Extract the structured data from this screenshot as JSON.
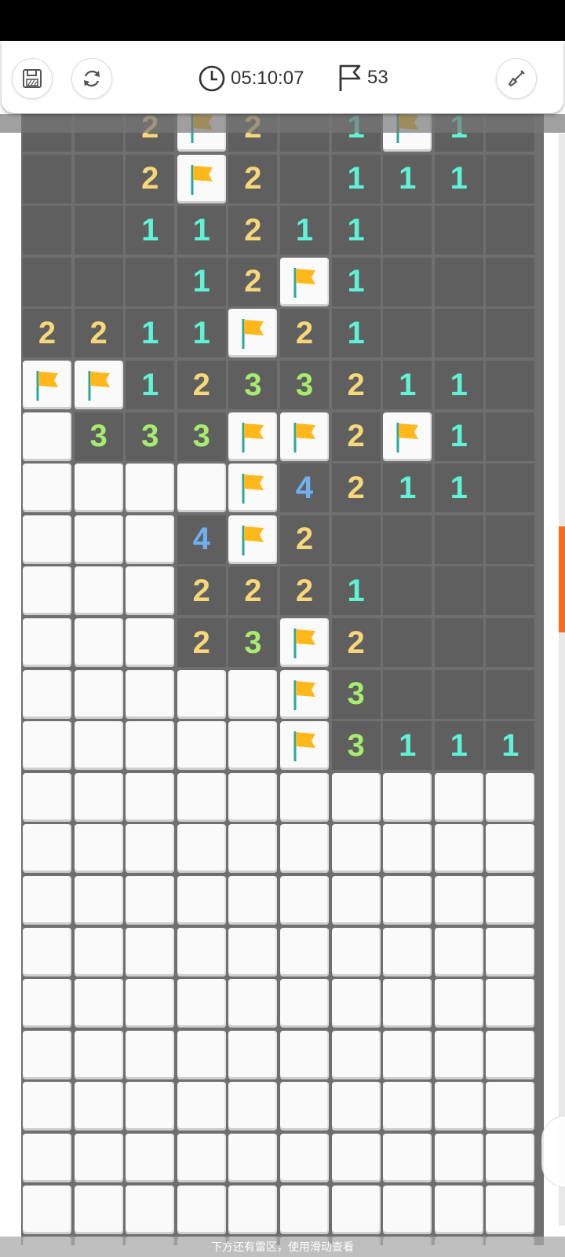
{
  "header": {
    "timer": "05:10:07",
    "flags_count": "53"
  },
  "footer": {
    "hint": "下方还有雷区，使用滑动查看"
  },
  "colors": {
    "num_1": "#5ff2d4",
    "num_2": "#f7d77a",
    "num_3": "#a6ec6e",
    "num_4": "#6fb0ee",
    "flag": "#ffb81c",
    "revealed": "#5f5f5f",
    "grid": "#6f6f6f",
    "unrevealed": "#fafafa",
    "accent": "#ff6a1a"
  },
  "icons": [
    "save-icon",
    "restart-icon",
    "clock-icon",
    "flag-outline-icon",
    "shovel-icon",
    "flag-icon"
  ],
  "board": {
    "rows": [
      [
        "R",
        "R",
        "2",
        "F",
        "2",
        "R",
        "1",
        "F",
        "1",
        "R"
      ],
      [
        "R",
        "R",
        "2",
        "F",
        "2",
        "R",
        "1",
        "1",
        "1",
        "R"
      ],
      [
        "R",
        "R",
        "1",
        "1",
        "2",
        "1",
        "1",
        "R",
        "R",
        "R"
      ],
      [
        "R",
        "R",
        "R",
        "1",
        "2",
        "F",
        "1",
        "R",
        "R",
        "R"
      ],
      [
        "2",
        "2",
        "1",
        "1",
        "F",
        "2",
        "1",
        "R",
        "R",
        "R"
      ],
      [
        "F",
        "F",
        "1",
        "2",
        "3",
        "3",
        "2",
        "1",
        "1",
        "R"
      ],
      [
        "U",
        "3",
        "3",
        "3",
        "F",
        "F",
        "2",
        "F",
        "1",
        "R"
      ],
      [
        "U",
        "U",
        "U",
        "U",
        "F",
        "4",
        "2",
        "1",
        "1",
        "R"
      ],
      [
        "U",
        "U",
        "U",
        "4",
        "F",
        "2",
        "R",
        "R",
        "R",
        "R"
      ],
      [
        "U",
        "U",
        "U",
        "2",
        "2",
        "2",
        "1",
        "R",
        "R",
        "R"
      ],
      [
        "U",
        "U",
        "U",
        "2",
        "3",
        "F",
        "2",
        "R",
        "R",
        "R"
      ],
      [
        "U",
        "U",
        "U",
        "U",
        "U",
        "F",
        "3",
        "R",
        "R",
        "R"
      ],
      [
        "U",
        "U",
        "U",
        "U",
        "U",
        "F",
        "3",
        "1",
        "1",
        "1"
      ],
      [
        "U",
        "U",
        "U",
        "U",
        "U",
        "U",
        "U",
        "U",
        "U",
        "U"
      ],
      [
        "U",
        "U",
        "U",
        "U",
        "U",
        "U",
        "U",
        "U",
        "U",
        "U"
      ],
      [
        "U",
        "U",
        "U",
        "U",
        "U",
        "U",
        "U",
        "U",
        "U",
        "U"
      ],
      [
        "U",
        "U",
        "U",
        "U",
        "U",
        "U",
        "U",
        "U",
        "U",
        "U"
      ],
      [
        "U",
        "U",
        "U",
        "U",
        "U",
        "U",
        "U",
        "U",
        "U",
        "U"
      ],
      [
        "U",
        "U",
        "U",
        "U",
        "U",
        "U",
        "U",
        "U",
        "U",
        "U"
      ],
      [
        "U",
        "U",
        "U",
        "U",
        "U",
        "U",
        "U",
        "U",
        "U",
        "U"
      ],
      [
        "U",
        "U",
        "U",
        "U",
        "U",
        "U",
        "U",
        "U",
        "U",
        "U"
      ],
      [
        "U",
        "U",
        "U",
        "U",
        "U",
        "U",
        "U",
        "U",
        "U",
        "U"
      ],
      [
        "U",
        "U",
        "U",
        "U",
        "U",
        "U",
        "U",
        "U",
        "U",
        "U"
      ]
    ]
  }
}
